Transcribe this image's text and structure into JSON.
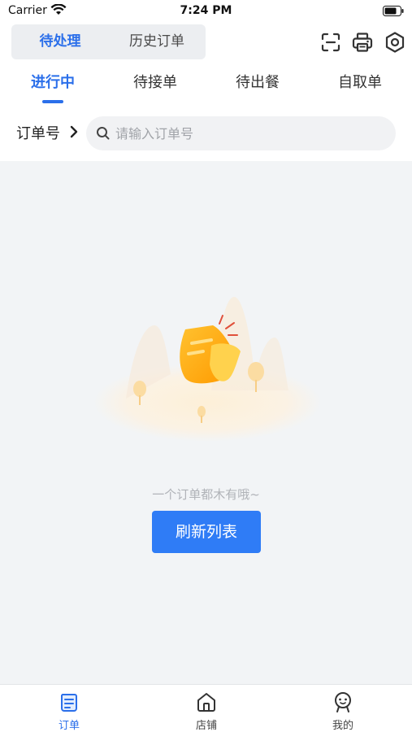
{
  "status_bar": {
    "carrier": "Carrier",
    "time": "7:24 PM"
  },
  "segment": {
    "items": [
      {
        "label": "待处理",
        "active": true
      },
      {
        "label": "历史订单",
        "active": false
      }
    ]
  },
  "top_icons": [
    "scan-icon",
    "printer-icon",
    "settings-icon"
  ],
  "tabs": [
    {
      "label": "进行中",
      "active": true
    },
    {
      "label": "待接单",
      "active": false
    },
    {
      "label": "待出餐",
      "active": false
    },
    {
      "label": "自取单",
      "active": false
    }
  ],
  "search": {
    "filter_label": "订单号",
    "placeholder": "请输入订单号",
    "value": ""
  },
  "empty_state": {
    "message": "一个订单都木有哦~",
    "button_label": "刷新列表"
  },
  "bottom_nav": [
    {
      "label": "订单",
      "icon": "order-icon",
      "active": true
    },
    {
      "label": "店铺",
      "icon": "store-icon",
      "active": false
    },
    {
      "label": "我的",
      "icon": "profile-icon",
      "active": false
    }
  ],
  "colors": {
    "accent": "#2b6fea",
    "button": "#2f7cf6",
    "background": "#f2f4f6",
    "illustration": "#ffb21a"
  }
}
